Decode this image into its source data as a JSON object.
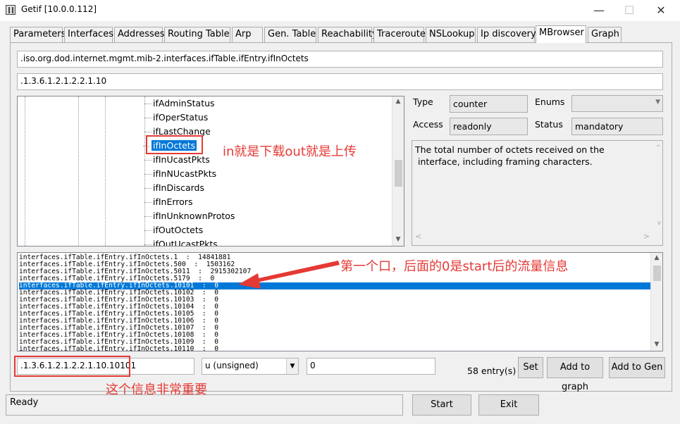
{
  "window": {
    "title": "Getif [10.0.0.112]",
    "minimize": "—",
    "maximize": "☐",
    "close": "✕"
  },
  "tabs": [
    {
      "label": "Parameters"
    },
    {
      "label": "Interfaces"
    },
    {
      "label": "Addresses"
    },
    {
      "label": "Routing Table"
    },
    {
      "label": "Arp"
    },
    {
      "label": "Gen. Table"
    },
    {
      "label": "Reachability"
    },
    {
      "label": "Traceroute"
    },
    {
      "label": "NSLookup"
    },
    {
      "label": "Ip discovery"
    },
    {
      "label": "MBrowser"
    },
    {
      "label": "Graph"
    }
  ],
  "active_tab": "MBrowser",
  "oid_name_field": ".iso.org.dod.internet.mgmt.mib-2.interfaces.ifTable.ifEntry.ifInOctets",
  "oid_number_field": ".1.3.6.1.2.1.2.2.1.10",
  "tree": {
    "items": [
      {
        "label": "ifAdminStatus"
      },
      {
        "label": "ifOperStatus"
      },
      {
        "label": "ifLastChange"
      },
      {
        "label": "ifInOctets"
      },
      {
        "label": "ifInUcastPkts"
      },
      {
        "label": "ifInNUcastPkts"
      },
      {
        "label": "ifInDiscards"
      },
      {
        "label": "ifInErrors"
      },
      {
        "label": "ifInUnknownProtos"
      },
      {
        "label": "ifOutOctets"
      },
      {
        "label": "ifOutUcastPkts"
      }
    ],
    "selected": "ifInOctets"
  },
  "details": {
    "type_label": "Type",
    "type_value": "counter",
    "enums_label": "Enums",
    "enums_value": "",
    "access_label": "Access",
    "access_value": "readonly",
    "status_label": "Status",
    "status_value": "mandatory",
    "description": "The total number of octets received on the\n interface, including framing characters."
  },
  "results": {
    "rows": [
      {
        "text": "interfaces.ifTable.ifEntry.ifInOctets.1  :  14841881"
      },
      {
        "text": "interfaces.ifTable.ifEntry.ifInOctets.500  :  1503162"
      },
      {
        "text": "interfaces.ifTable.ifEntry.ifInOctets.5011  :  2915302107"
      },
      {
        "text": "interfaces.ifTable.ifEntry.ifInOctets.5179  :  0"
      },
      {
        "text": "interfaces.ifTable.ifEntry.ifInOctets.10101  :  0"
      },
      {
        "text": "interfaces.ifTable.ifEntry.ifInOctets.10102  :  0"
      },
      {
        "text": "interfaces.ifTable.ifEntry.ifInOctets.10103  :  0"
      },
      {
        "text": "interfaces.ifTable.ifEntry.ifInOctets.10104  :  0"
      },
      {
        "text": "interfaces.ifTable.ifEntry.ifInOctets.10105  :  0"
      },
      {
        "text": "interfaces.ifTable.ifEntry.ifInOctets.10106  :  0"
      },
      {
        "text": "interfaces.ifTable.ifEntry.ifInOctets.10107  :  0"
      },
      {
        "text": "interfaces.ifTable.ifEntry.ifInOctets.10108  :  0"
      },
      {
        "text": "interfaces.ifTable.ifEntry.ifInOctets.10109  :  0"
      },
      {
        "text": "interfaces.ifTable.ifEntry.ifInOctets.10110  :  0"
      }
    ],
    "selected_index": 4
  },
  "bottom": {
    "oid_value": ".1.3.6.1.2.1.2.2.1.10.10101",
    "type_select": "u (unsigned)",
    "value_field": "0",
    "entry_count": "58 entry(s)",
    "set_button": "Set",
    "add_graph_button": "Add to graph",
    "add_gen_button": "Add to Gen"
  },
  "status": {
    "text": "Ready",
    "start_button": "Start",
    "exit_button": "Exit"
  },
  "annotations": {
    "in_out": "in就是下载out就是上传",
    "first_port": "第一个口，后面的0是start后的流量信息",
    "important": "这个信息非常重要",
    "color": "#e53935"
  },
  "colors": {
    "selection": "#0078d7",
    "annotation": "#e53935"
  }
}
